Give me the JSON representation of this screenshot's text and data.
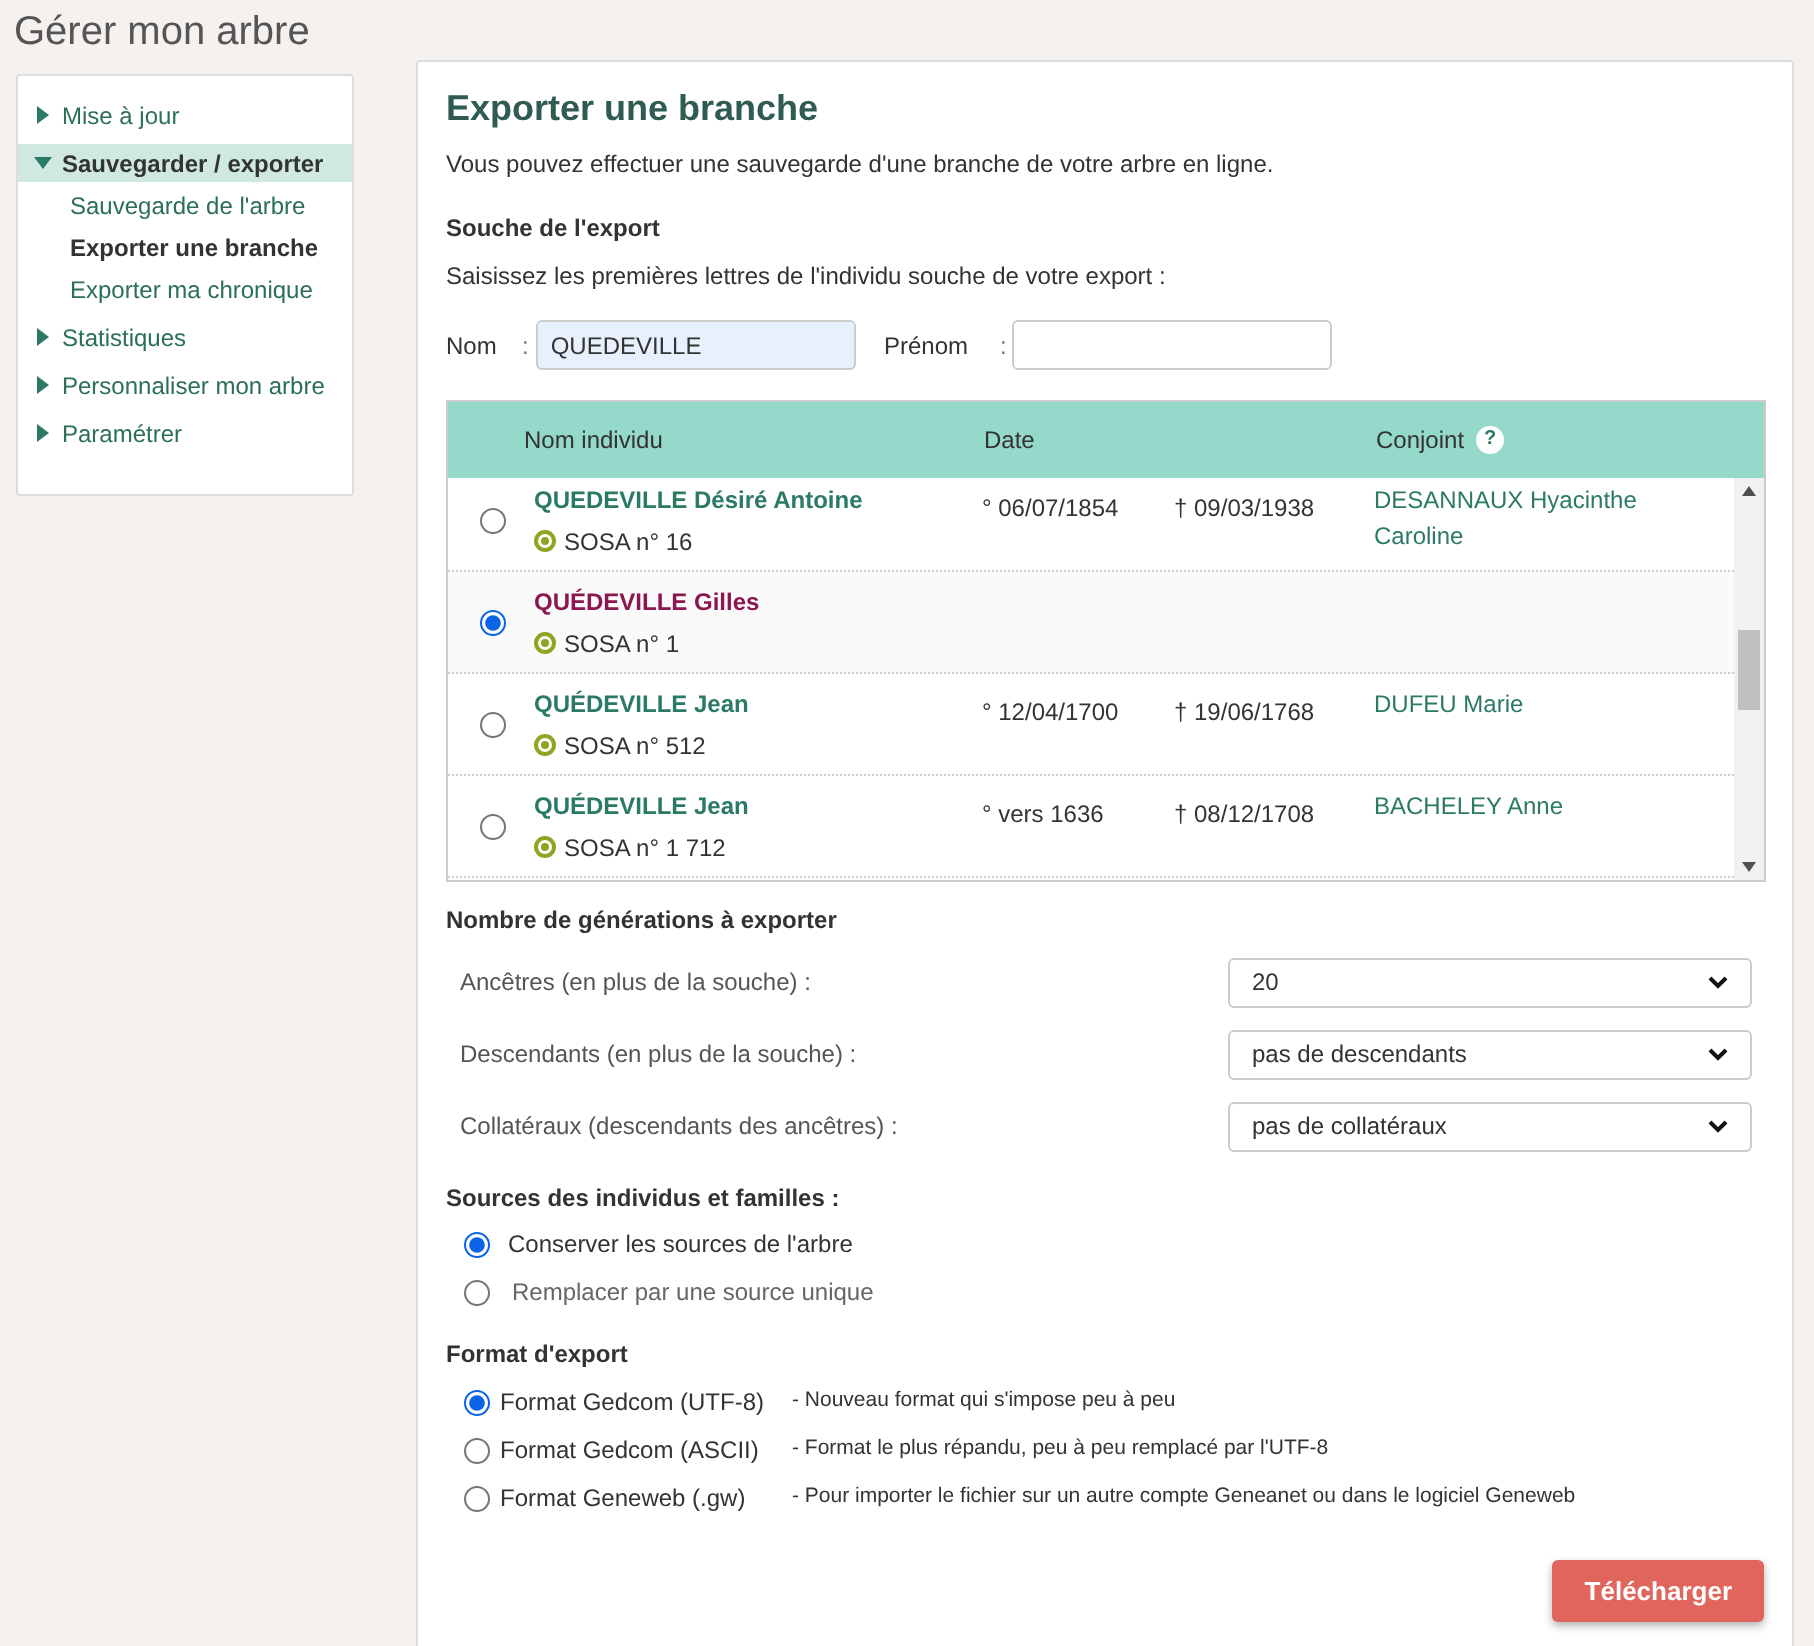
{
  "page_title": "Gérer mon arbre",
  "sidebar": {
    "items": [
      {
        "label": "Mise à jour",
        "expanded": false,
        "selected": false
      },
      {
        "label": "Sauvegarder / exporter",
        "expanded": true,
        "selected": true,
        "children": [
          {
            "label": "Sauvegarde de l'arbre",
            "selected": false
          },
          {
            "label": "Exporter une branche",
            "selected": true
          },
          {
            "label": "Exporter ma chronique",
            "selected": false
          }
        ]
      },
      {
        "label": "Statistiques",
        "expanded": false,
        "selected": false
      },
      {
        "label": "Personnaliser mon arbre",
        "expanded": false,
        "selected": false
      },
      {
        "label": "Paramétrer",
        "expanded": false,
        "selected": false
      }
    ]
  },
  "main": {
    "title": "Exporter une branche",
    "intro": "Vous pouvez effectuer une sauvegarde d'une branche de votre arbre en ligne.",
    "source_heading": "Souche de l'export",
    "source_hint": "Saisissez les premières lettres de l'individu souche de votre export :",
    "fields": [
      {
        "label": "Nom",
        "separator": ":",
        "value": "QUEDEVILLE",
        "filled": true
      },
      {
        "label": "Prénom",
        "separator": ":",
        "filled": false
      }
    ],
    "table": {
      "columns": [
        "Nom individu",
        "Date",
        "Conjoint"
      ],
      "help_mark": "?",
      "rows": [
        {
          "name": "QUEDEVILLE Désiré Antoine",
          "sosa": "SOSA n° 16",
          "birth": "° 06/07/1854",
          "death": "† 09/03/1938",
          "spouse": "DESANNAUX Hyacinthe Caroline",
          "selected": false
        },
        {
          "name": "QUÉDEVILLE Gilles",
          "sosa": "SOSA n° 1",
          "selected": true
        },
        {
          "name": "QUÉDEVILLE Jean",
          "sosa": "SOSA n° 512",
          "birth": "° 12/04/1700",
          "death": "† 19/06/1768",
          "spouse": "DUFEU Marie",
          "selected": false
        },
        {
          "name": "QUÉDEVILLE Jean",
          "sosa": "SOSA n° 1 712",
          "birth": "° vers 1636",
          "death": "† 08/12/1708",
          "spouse": "BACHELEY Anne",
          "selected": false
        }
      ]
    },
    "generations": {
      "heading": "Nombre de générations à exporter",
      "rows": [
        {
          "label": "Ancêtres (en plus de la souche) :",
          "value": "20"
        },
        {
          "label": "Descendants (en plus de la souche) :",
          "value": "pas de descendants"
        },
        {
          "label": "Collatéraux (descendants des ancêtres) :",
          "value": "pas de collatéraux"
        }
      ]
    },
    "sources": {
      "heading": "Sources des individus et familles :",
      "options": [
        {
          "label": "Conserver les sources de l'arbre",
          "selected": true
        },
        {
          "label": "Remplacer par une source unique",
          "selected": false
        }
      ]
    },
    "format": {
      "heading": "Format d'export",
      "options": [
        {
          "label": "Format Gedcom (UTF-8)",
          "note": "- Nouveau format qui s'impose peu à peu",
          "selected": true
        },
        {
          "label": "Format Gedcom (ASCII)",
          "note": "- Format le plus répandu, peu à peu remplacé par l'UTF-8",
          "selected": false
        },
        {
          "label": "Format Geneweb (.gw)",
          "note": "- Pour importer le fichier sur un autre compte Geneanet ou dans le logiciel Geneweb",
          "selected": false
        }
      ]
    },
    "download_button": "Télécharger"
  }
}
